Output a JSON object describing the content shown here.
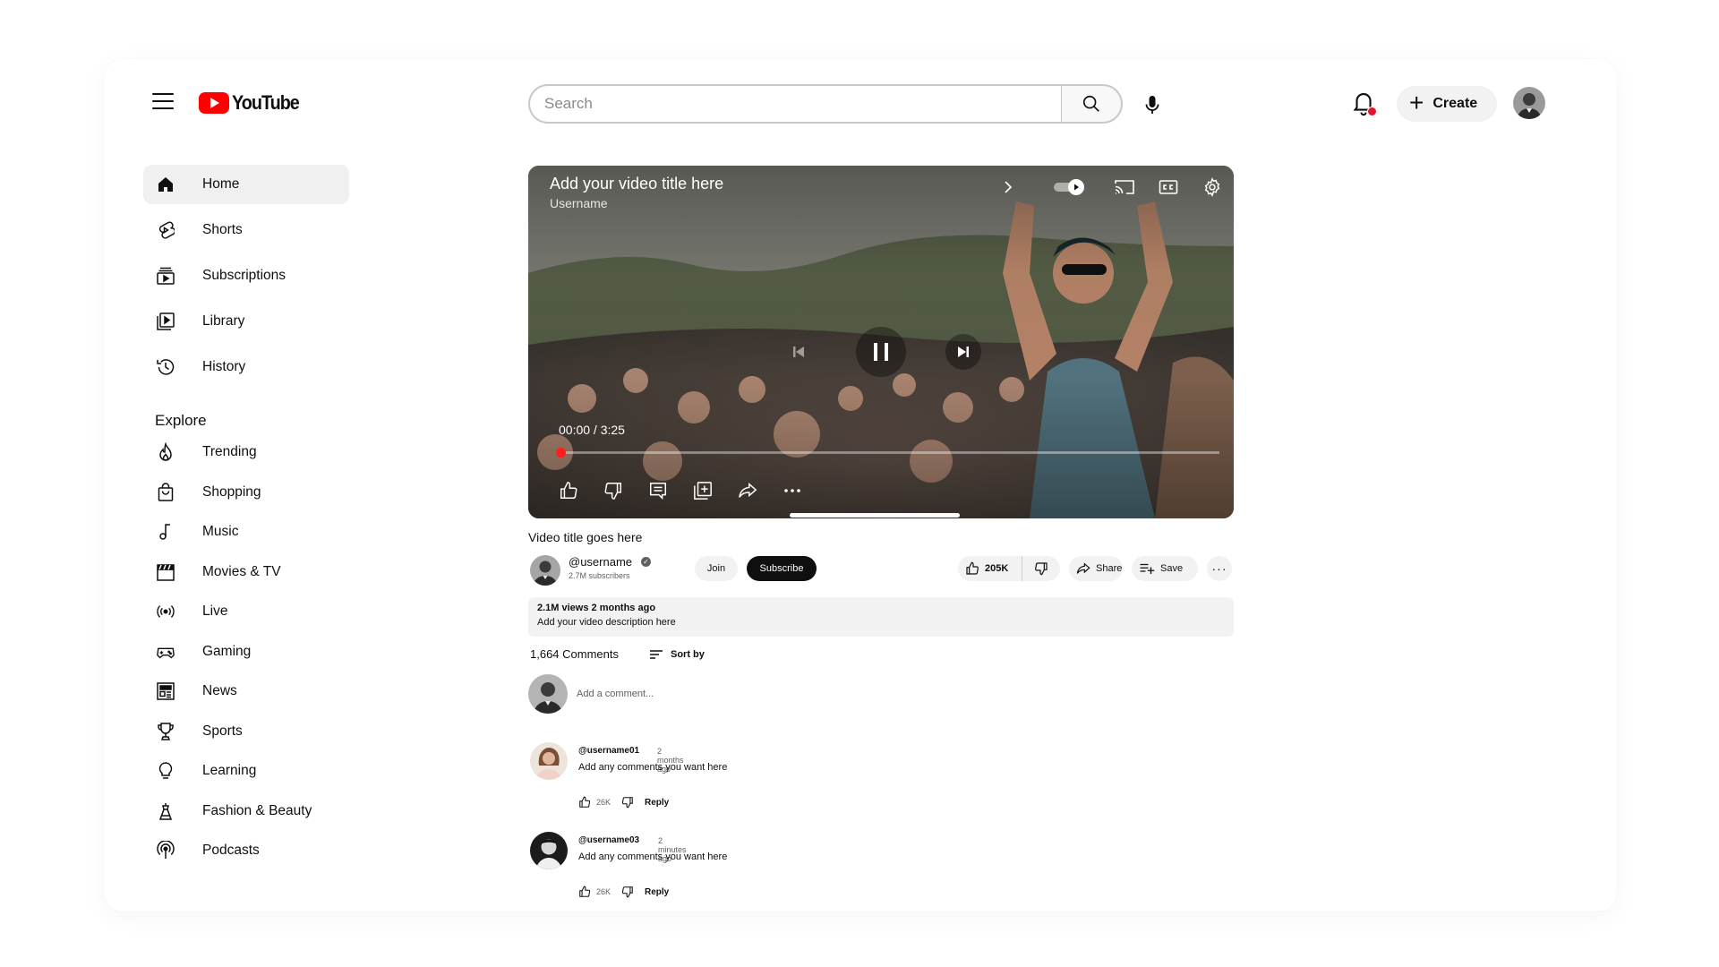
{
  "header": {
    "logo_text": "YouTube",
    "search_placeholder": "Search",
    "create_label": "Create"
  },
  "sidebar": {
    "items": [
      {
        "label": "Home",
        "icon": "home-icon",
        "active": true
      },
      {
        "label": "Shorts",
        "icon": "shorts-icon"
      },
      {
        "label": "Subscriptions",
        "icon": "subscriptions-icon"
      },
      {
        "label": "Library",
        "icon": "library-icon"
      },
      {
        "label": "History",
        "icon": "history-icon"
      }
    ],
    "explore_heading": "Explore",
    "explore": [
      {
        "label": "Trending",
        "icon": "trending-icon"
      },
      {
        "label": "Shopping",
        "icon": "shopping-bag-icon"
      },
      {
        "label": "Music",
        "icon": "music-note-icon"
      },
      {
        "label": "Movies & TV",
        "icon": "clapperboard-icon"
      },
      {
        "label": "Live",
        "icon": "live-icon"
      },
      {
        "label": "Gaming",
        "icon": "gamepad-icon"
      },
      {
        "label": "News",
        "icon": "newspaper-icon"
      },
      {
        "label": "Sports",
        "icon": "trophy-icon"
      },
      {
        "label": "Learning",
        "icon": "lightbulb-icon"
      },
      {
        "label": "Fashion & Beauty",
        "icon": "hanger-icon"
      },
      {
        "label": "Podcasts",
        "icon": "podcast-icon"
      }
    ]
  },
  "player": {
    "title": "Add your video title here",
    "username": "Username",
    "time": "00:00 / 3:25",
    "progress": 0
  },
  "video": {
    "title": "Video title goes here",
    "channel": "@username",
    "subscribers": "2.7M subscribers",
    "join_label": "Join",
    "subscribe_label": "Subscribe",
    "likes": "205K",
    "share_label": "Share",
    "save_label": "Save",
    "stats": "2.1M views 2 months ago",
    "description": "Add your video description here"
  },
  "comments": {
    "count": "1,664 Comments",
    "sort_label": "Sort by",
    "add_placeholder": "Add a comment...",
    "items": [
      {
        "user": "@username01",
        "time": "2 months ago",
        "text": "Add any comments you want here",
        "likes": "26K",
        "reply": "Reply"
      },
      {
        "user": "@username03",
        "time": "2 minutes ago",
        "text": "Add any comments you want here",
        "likes": "26K",
        "reply": "Reply"
      }
    ]
  },
  "colors": {
    "brand_red": "#ff0000",
    "notification_dot": "#e8132a",
    "progress_knob": "#ff1d1d"
  }
}
